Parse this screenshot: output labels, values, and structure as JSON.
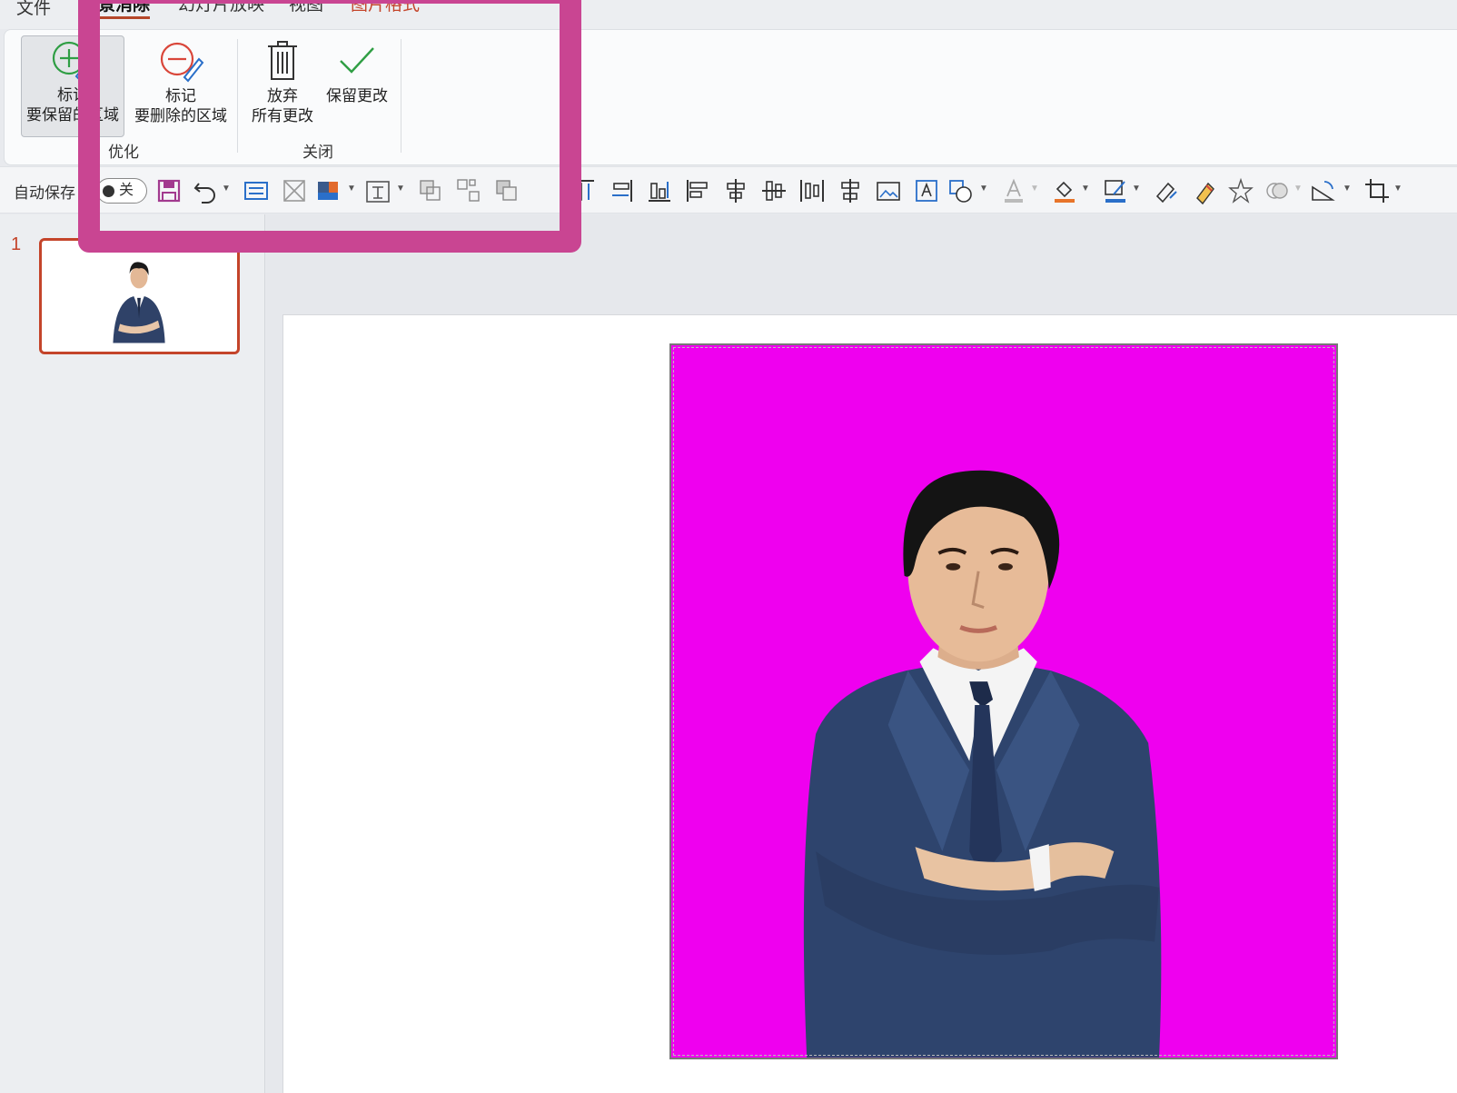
{
  "menu": {
    "file": "文件",
    "background_removal": "景消除",
    "slideshow": "幻灯片放映",
    "view": "视图",
    "picture_format": "图片格式"
  },
  "ribbon": {
    "mark_keep_line1": "标记",
    "mark_keep_line2": "要保留的区域",
    "mark_remove_line1": "标记",
    "mark_remove_line2": "要删除的区域",
    "refine_group": "优化",
    "discard_line1": "放弃",
    "discard_line2": "所有更改",
    "keep_changes": "保留更改",
    "close_group": "关闭"
  },
  "qat": {
    "autosave_label": "自动保存",
    "autosave_state": "关"
  },
  "slides": {
    "current_number": "1"
  },
  "colors": {
    "accent": "#c4442a",
    "highlight": "#c94592",
    "removed_background": "#ef00ef"
  }
}
